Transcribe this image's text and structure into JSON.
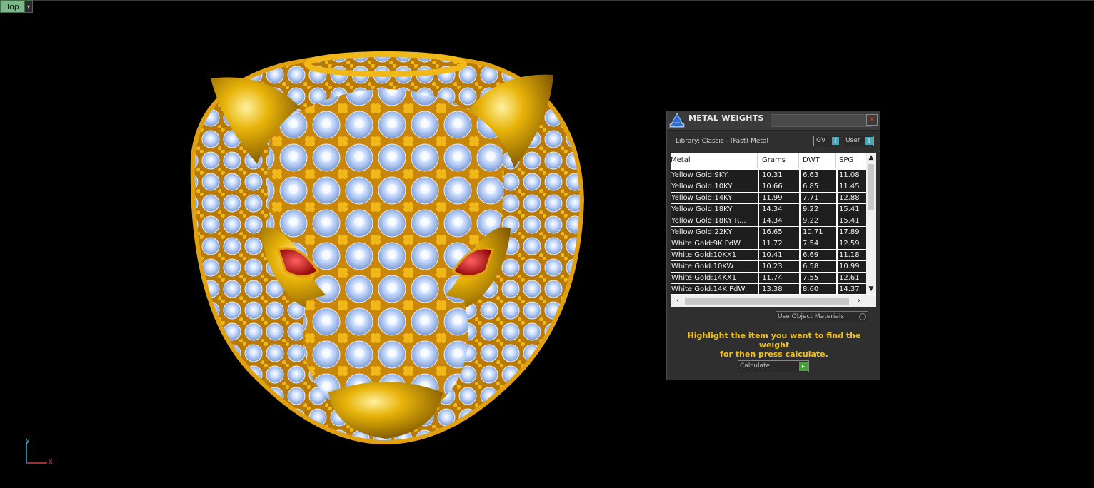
{
  "viewport": {
    "label": "Top",
    "dropdown_glyph": "▾"
  },
  "axis": {
    "y_label": "y",
    "x_label": "x"
  },
  "panel": {
    "title": "METAL WEIGHTS",
    "close_glyph": "✕",
    "library": "Library: Classic - (Fast)-Metal",
    "toggle_gv": "GV",
    "toggle_user": "User",
    "toggle_glyph": "I",
    "columns": [
      "Metal",
      "Grams",
      "DWT",
      "SPG"
    ],
    "rows": [
      [
        "Yellow Gold:9KY",
        "10.31",
        "6.63",
        "11.08"
      ],
      [
        "Yellow Gold:10KY",
        "10.66",
        "6.85",
        "11.45"
      ],
      [
        "Yellow Gold:14KY",
        "11.99",
        "7.71",
        "12.88"
      ],
      [
        "Yellow Gold:18KY",
        "14.34",
        "9.22",
        "15.41"
      ],
      [
        "Yellow Gold:18KY R...",
        "14.34",
        "9.22",
        "15.41"
      ],
      [
        "Yellow Gold:22KY",
        "16.65",
        "10.71",
        "17.89"
      ],
      [
        "White Gold:9K PdW",
        "11.72",
        "7.54",
        "12.59"
      ],
      [
        "White Gold:10KX1",
        "10.41",
        "6.69",
        "11.18"
      ],
      [
        "White Gold:10KW",
        "10.23",
        "6.58",
        "10.99"
      ],
      [
        "White Gold:14KX1",
        "11.74",
        "7.55",
        "12.61"
      ],
      [
        "White Gold:14K PdW",
        "13.38",
        "8.60",
        "14.37"
      ]
    ],
    "use_object_materials": "Use Object Materials",
    "hint_line1": "Highlight the item you want to find the weight",
    "hint_line2": "for then press calculate.",
    "calculate": "Calculate",
    "calculate_glyph": "▸"
  },
  "colors": {
    "accent_gold": "#f3c21a",
    "viewport_label_bg": "#7fb68a"
  }
}
